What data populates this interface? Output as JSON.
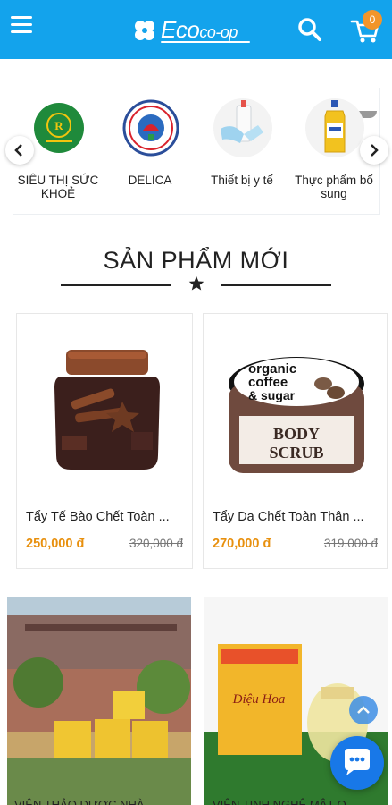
{
  "header": {
    "logo_main": "Eco",
    "logo_sub": "co-op",
    "cart_count": "0",
    "brand_color": "#13a3ec"
  },
  "categories": [
    {
      "label": "SIÊU THỊ SỨC KHOẺ"
    },
    {
      "label": "DELICA"
    },
    {
      "label": "Thiết bị y tế"
    },
    {
      "label": "Thực phẩm bổ sung"
    }
  ],
  "section": {
    "title": "SẢN PHẨM MỚI"
  },
  "products": [
    {
      "name": "Tẩy Tế Bào Chết Toàn ...",
      "price": "250,000 đ",
      "old_price": "320,000 đ"
    },
    {
      "name": "Tẩy Da Chết Toàn Thân ...",
      "price": "270,000 đ",
      "old_price": "319,000 đ"
    }
  ],
  "products_row2": [
    {
      "name": "VIÊN THẢO DƯỢC NHÀ..."
    },
    {
      "name": "VIÊN TINH NGHỆ MẬT O..."
    }
  ],
  "product_image_text": {
    "organic": "organic",
    "coffee": "coffee",
    "sugar": "& sugar",
    "body": "BODY",
    "scrub": "SCRUB",
    "dieu_hoa": "Diệu Hoa"
  }
}
